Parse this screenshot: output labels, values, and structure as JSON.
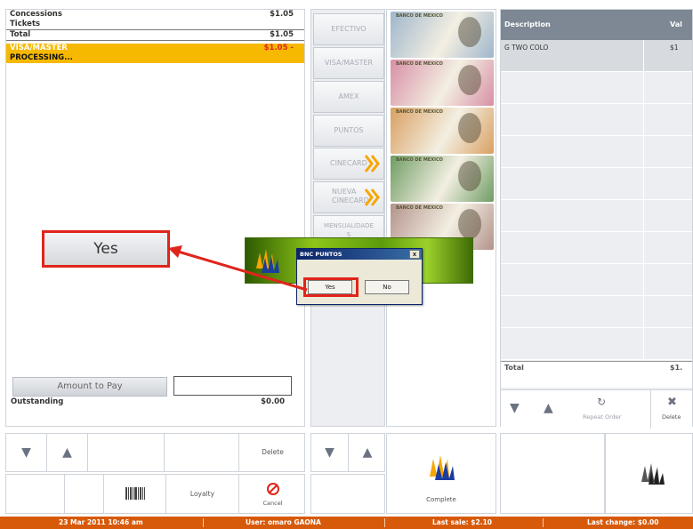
{
  "summary": {
    "rows": [
      {
        "label": "Concessions",
        "amount": "$1.05"
      },
      {
        "label": "Tickets",
        "amount": ""
      },
      {
        "label": "Total",
        "amount": "$1.05"
      },
      {
        "label": "VISA/MASTER",
        "amount": "$1.05 -"
      },
      {
        "label": "PROCESSING...",
        "amount": ""
      }
    ],
    "amount_to_pay_label": "Amount to Pay",
    "amount_to_pay_value": "",
    "outstanding_label": "Outstanding",
    "outstanding_value": "$0.00"
  },
  "payment_methods": [
    {
      "label": "EFECTIVO"
    },
    {
      "label": "VISA/MASTER"
    },
    {
      "label": "AMEX"
    },
    {
      "label": "PUNTOS"
    },
    {
      "label": "CINECARD"
    },
    {
      "label_line1": "NUEVA",
      "label_line2": "CINECARD"
    },
    {
      "label_line1": "MENSUALIDADE",
      "label_line2": "S"
    }
  ],
  "bills": [
    {
      "label": "BANCO DE MEXICO",
      "color": "#9fb6cc"
    },
    {
      "label": "BANCO DE MEXICO",
      "color": "#d88fa6"
    },
    {
      "label": "BANCO DE MEXICO",
      "color": "#d9a062"
    },
    {
      "label": "BANCO DE MEXICO",
      "color": "#6f9c63"
    },
    {
      "label": "BANCO DE MEXICO",
      "color": "#b3938c"
    }
  ],
  "order": {
    "col_description": "Description",
    "col_value": "Val",
    "item_description": "G TWO COLO",
    "item_value": "$1",
    "total_label": "Total",
    "total_value": "$1.",
    "repeat_order_label": "Repeat Order",
    "delete_label": "Delete"
  },
  "toolbar": {
    "delete_label": "Delete",
    "loyalty_label": "Loyalty",
    "cancel_label": "Cancel",
    "complete_label": "Complete"
  },
  "status_bar": {
    "datetime": "23 Mar 2011 10:46 am",
    "user": "User: omaro GAONA",
    "last_sale": "Last sale: $2.10",
    "last_change": "Last change: $0.00"
  },
  "dialog": {
    "title": "BNC PUNTOS",
    "close_glyph": "x",
    "yes_label": "Yes",
    "no_label": "No"
  },
  "callout": {
    "yes_label": "Yes"
  },
  "colors": {
    "status_bar": "#d75a0a",
    "processing_highlight": "#f7b900",
    "callout_red": "#e0251b",
    "table_header": "#7e8894"
  }
}
